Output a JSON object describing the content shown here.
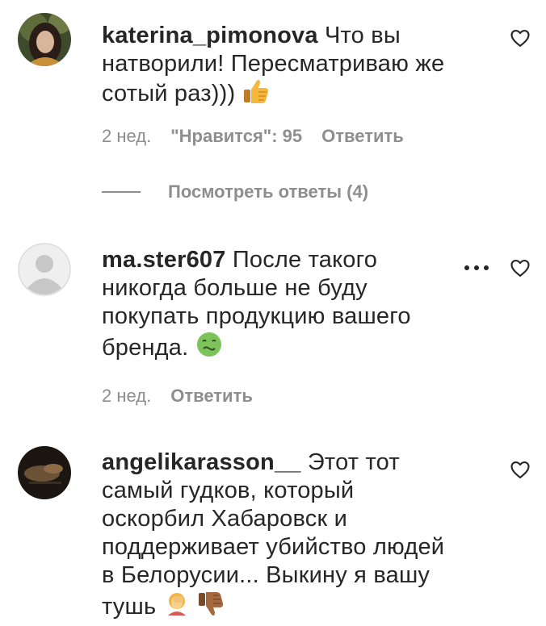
{
  "comments": [
    {
      "username": "katerina_pimonova",
      "text_lines": [
        "Что вы",
        "натворили! Пересматриваю же",
        "сотый раз)))"
      ],
      "emoji": "thumbs-up",
      "time": "2 нед.",
      "likes": "\"Нравится\": 95",
      "reply": "Ответить"
    },
    {
      "username": "ma.ster607",
      "text_lines": [
        "После такого",
        "никогда больше не буду",
        "покупать продукцию вашего",
        "бренда."
      ],
      "emoji": "nauseated-face",
      "time": "2 нед.",
      "reply": "Ответить"
    },
    {
      "username": "angelikarasson__",
      "text_lines": [
        "Этот тот",
        "самый гудков, который",
        "оскорбил Хабаровск и",
        "поддерживает убийство людей",
        "в Белорусии... Выкину я вашу",
        "тушь"
      ],
      "emojis": [
        "woman-facepalming",
        "thumbs-down"
      ]
    }
  ],
  "view_replies": "Посмотреть ответы (4)",
  "icons": {
    "heart": "heart-outline-icon",
    "more": "more-options-icon"
  },
  "colors": {
    "text": "#262626",
    "secondary": "#8e8e8e"
  }
}
